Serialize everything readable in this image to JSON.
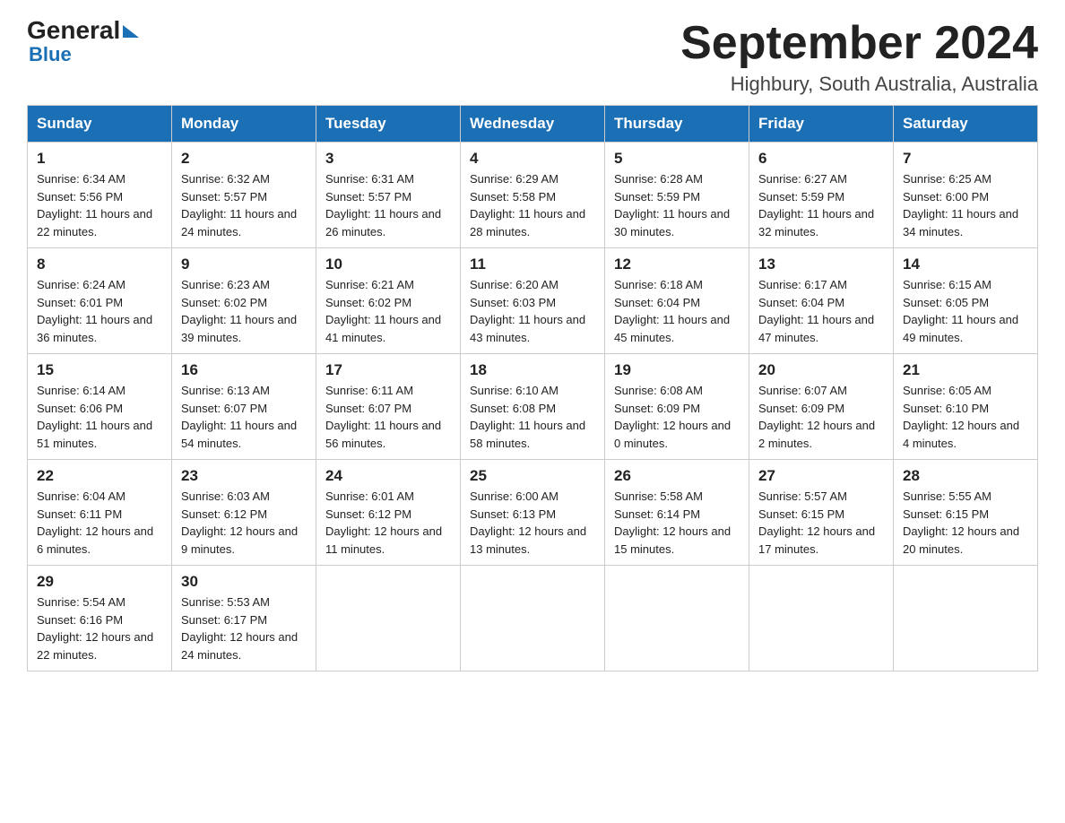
{
  "header": {
    "logo_general": "General",
    "logo_blue": "Blue",
    "month_title": "September 2024",
    "location": "Highbury, South Australia, Australia"
  },
  "days_of_week": [
    "Sunday",
    "Monday",
    "Tuesday",
    "Wednesday",
    "Thursday",
    "Friday",
    "Saturday"
  ],
  "weeks": [
    [
      {
        "day": "1",
        "sunrise": "6:34 AM",
        "sunset": "5:56 PM",
        "daylight": "11 hours and 22 minutes."
      },
      {
        "day": "2",
        "sunrise": "6:32 AM",
        "sunset": "5:57 PM",
        "daylight": "11 hours and 24 minutes."
      },
      {
        "day": "3",
        "sunrise": "6:31 AM",
        "sunset": "5:57 PM",
        "daylight": "11 hours and 26 minutes."
      },
      {
        "day": "4",
        "sunrise": "6:29 AM",
        "sunset": "5:58 PM",
        "daylight": "11 hours and 28 minutes."
      },
      {
        "day": "5",
        "sunrise": "6:28 AM",
        "sunset": "5:59 PM",
        "daylight": "11 hours and 30 minutes."
      },
      {
        "day": "6",
        "sunrise": "6:27 AM",
        "sunset": "5:59 PM",
        "daylight": "11 hours and 32 minutes."
      },
      {
        "day": "7",
        "sunrise": "6:25 AM",
        "sunset": "6:00 PM",
        "daylight": "11 hours and 34 minutes."
      }
    ],
    [
      {
        "day": "8",
        "sunrise": "6:24 AM",
        "sunset": "6:01 PM",
        "daylight": "11 hours and 36 minutes."
      },
      {
        "day": "9",
        "sunrise": "6:23 AM",
        "sunset": "6:02 PM",
        "daylight": "11 hours and 39 minutes."
      },
      {
        "day": "10",
        "sunrise": "6:21 AM",
        "sunset": "6:02 PM",
        "daylight": "11 hours and 41 minutes."
      },
      {
        "day": "11",
        "sunrise": "6:20 AM",
        "sunset": "6:03 PM",
        "daylight": "11 hours and 43 minutes."
      },
      {
        "day": "12",
        "sunrise": "6:18 AM",
        "sunset": "6:04 PM",
        "daylight": "11 hours and 45 minutes."
      },
      {
        "day": "13",
        "sunrise": "6:17 AM",
        "sunset": "6:04 PM",
        "daylight": "11 hours and 47 minutes."
      },
      {
        "day": "14",
        "sunrise": "6:15 AM",
        "sunset": "6:05 PM",
        "daylight": "11 hours and 49 minutes."
      }
    ],
    [
      {
        "day": "15",
        "sunrise": "6:14 AM",
        "sunset": "6:06 PM",
        "daylight": "11 hours and 51 minutes."
      },
      {
        "day": "16",
        "sunrise": "6:13 AM",
        "sunset": "6:07 PM",
        "daylight": "11 hours and 54 minutes."
      },
      {
        "day": "17",
        "sunrise": "6:11 AM",
        "sunset": "6:07 PM",
        "daylight": "11 hours and 56 minutes."
      },
      {
        "day": "18",
        "sunrise": "6:10 AM",
        "sunset": "6:08 PM",
        "daylight": "11 hours and 58 minutes."
      },
      {
        "day": "19",
        "sunrise": "6:08 AM",
        "sunset": "6:09 PM",
        "daylight": "12 hours and 0 minutes."
      },
      {
        "day": "20",
        "sunrise": "6:07 AM",
        "sunset": "6:09 PM",
        "daylight": "12 hours and 2 minutes."
      },
      {
        "day": "21",
        "sunrise": "6:05 AM",
        "sunset": "6:10 PM",
        "daylight": "12 hours and 4 minutes."
      }
    ],
    [
      {
        "day": "22",
        "sunrise": "6:04 AM",
        "sunset": "6:11 PM",
        "daylight": "12 hours and 6 minutes."
      },
      {
        "day": "23",
        "sunrise": "6:03 AM",
        "sunset": "6:12 PM",
        "daylight": "12 hours and 9 minutes."
      },
      {
        "day": "24",
        "sunrise": "6:01 AM",
        "sunset": "6:12 PM",
        "daylight": "12 hours and 11 minutes."
      },
      {
        "day": "25",
        "sunrise": "6:00 AM",
        "sunset": "6:13 PM",
        "daylight": "12 hours and 13 minutes."
      },
      {
        "day": "26",
        "sunrise": "5:58 AM",
        "sunset": "6:14 PM",
        "daylight": "12 hours and 15 minutes."
      },
      {
        "day": "27",
        "sunrise": "5:57 AM",
        "sunset": "6:15 PM",
        "daylight": "12 hours and 17 minutes."
      },
      {
        "day": "28",
        "sunrise": "5:55 AM",
        "sunset": "6:15 PM",
        "daylight": "12 hours and 20 minutes."
      }
    ],
    [
      {
        "day": "29",
        "sunrise": "5:54 AM",
        "sunset": "6:16 PM",
        "daylight": "12 hours and 22 minutes."
      },
      {
        "day": "30",
        "sunrise": "5:53 AM",
        "sunset": "6:17 PM",
        "daylight": "12 hours and 24 minutes."
      },
      null,
      null,
      null,
      null,
      null
    ]
  ],
  "labels": {
    "sunrise": "Sunrise:",
    "sunset": "Sunset:",
    "daylight": "Daylight:"
  }
}
